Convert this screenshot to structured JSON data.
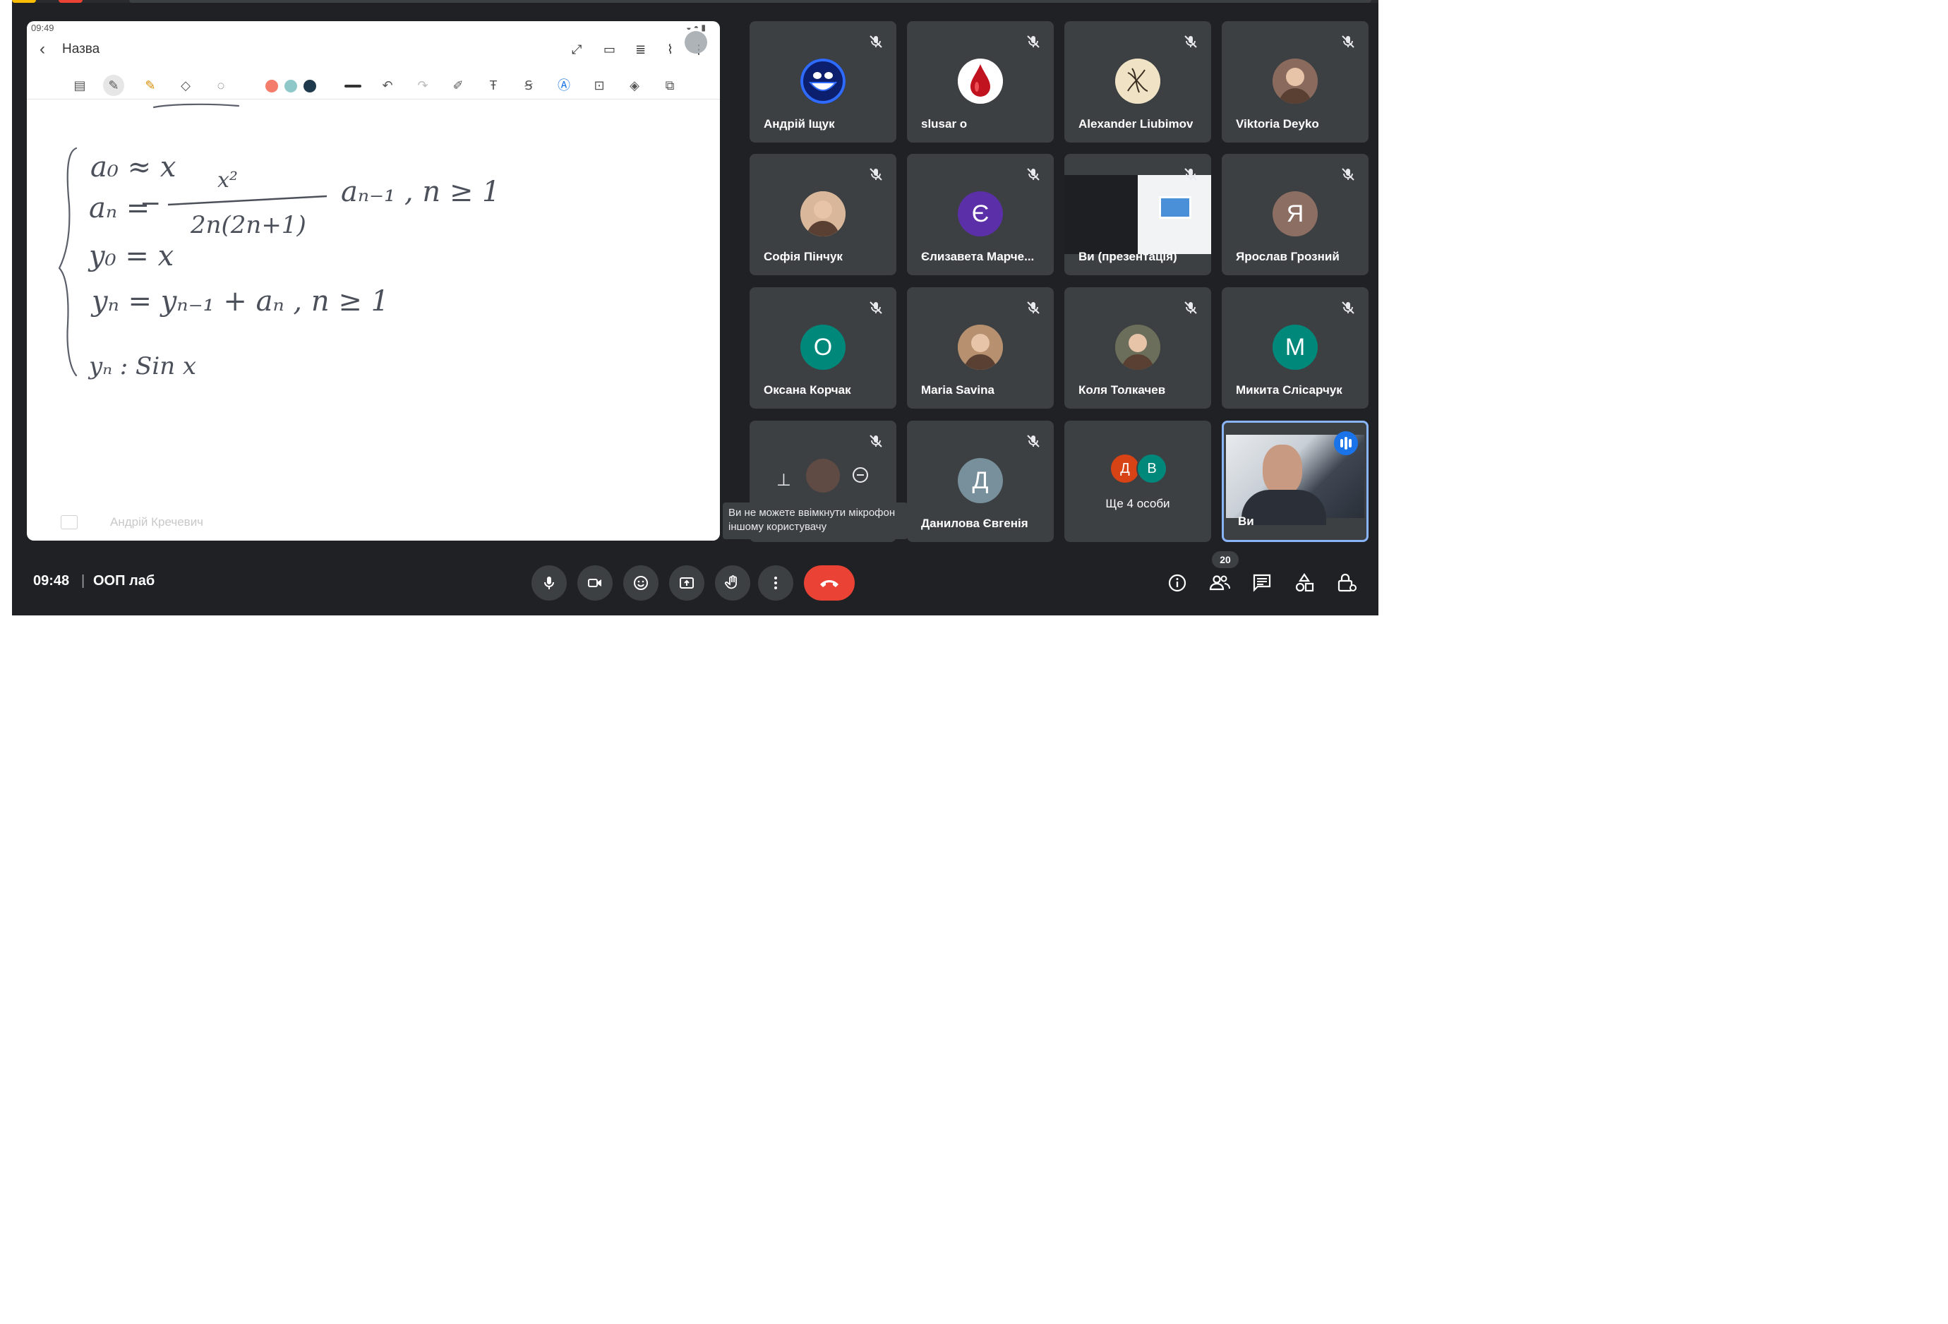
{
  "presentation": {
    "status_time": "09:49",
    "doc_title": "Назва",
    "presenter": "Андрій Кречевич",
    "pen_colors": [
      "#f47c6b",
      "#8fc8c9",
      "#1f3a4c"
    ],
    "formula_lines": [
      "a0 = x",
      "an = - x^2 / 2n(2n+1)  a(n-1) , n >= 1",
      "y0 = x",
      "yn = y(n-1) + an , n >= 1",
      "yn : Sin x"
    ]
  },
  "participants": [
    {
      "name": "Андрій Іщук",
      "avatar": "emoji-face",
      "color": "#0a2a8c"
    },
    {
      "name": "slusar o",
      "avatar": "blood-drop",
      "color": "#ffffff"
    },
    {
      "name": "Alexander Liubimov",
      "avatar": "sketch",
      "color": "#f0e2c4"
    },
    {
      "name": "Viktoria Deyko",
      "avatar": "photo",
      "color": "#8a6a5c"
    },
    {
      "name": "Софія Пінчук",
      "avatar": "photo",
      "color": "#d9b79a"
    },
    {
      "name": "Єлизавета Марче...",
      "initial": "Є",
      "color": "#5b2fa8"
    },
    {
      "name": "Ви (презентація)",
      "avatar": "screen-preview",
      "color": "#202124"
    },
    {
      "name": "Ярослав Грозний",
      "initial": "Я",
      "color": "#8d6e63"
    },
    {
      "name": "Оксана Корчак",
      "initial": "О",
      "color": "#00897b"
    },
    {
      "name": "Maria Savina",
      "avatar": "photo",
      "color": "#b7906f"
    },
    {
      "name": "Коля Толкачев",
      "avatar": "photo",
      "color": "#6a6e5a"
    },
    {
      "name": "Микита Слісарчук",
      "initial": "М",
      "color": "#00897b"
    },
    {
      "name": "",
      "avatar": "hover-controls",
      "color": "#3c4043"
    },
    {
      "name": "Данилова Євгенія",
      "initial": "Д",
      "color": "#78909c"
    },
    {
      "name": "Ще 4 особи",
      "initials": [
        "Д",
        "В"
      ],
      "colors": [
        "#d84315",
        "#00897b"
      ]
    },
    {
      "name": "Ви",
      "avatar": "self-video",
      "color": "#4a4f58"
    }
  ],
  "tooltip": {
    "text": "Ви не можете ввімкнути мікрофон іншому користувачу"
  },
  "bottom_bar": {
    "clock": "09:48",
    "separator": "|",
    "meeting_name": "ООП лаб",
    "people_count": "20"
  },
  "colors": {
    "meet_bg": "#202124",
    "tile_bg": "#3c4043",
    "end_call": "#ea4335",
    "accent": "#1a73e8"
  }
}
